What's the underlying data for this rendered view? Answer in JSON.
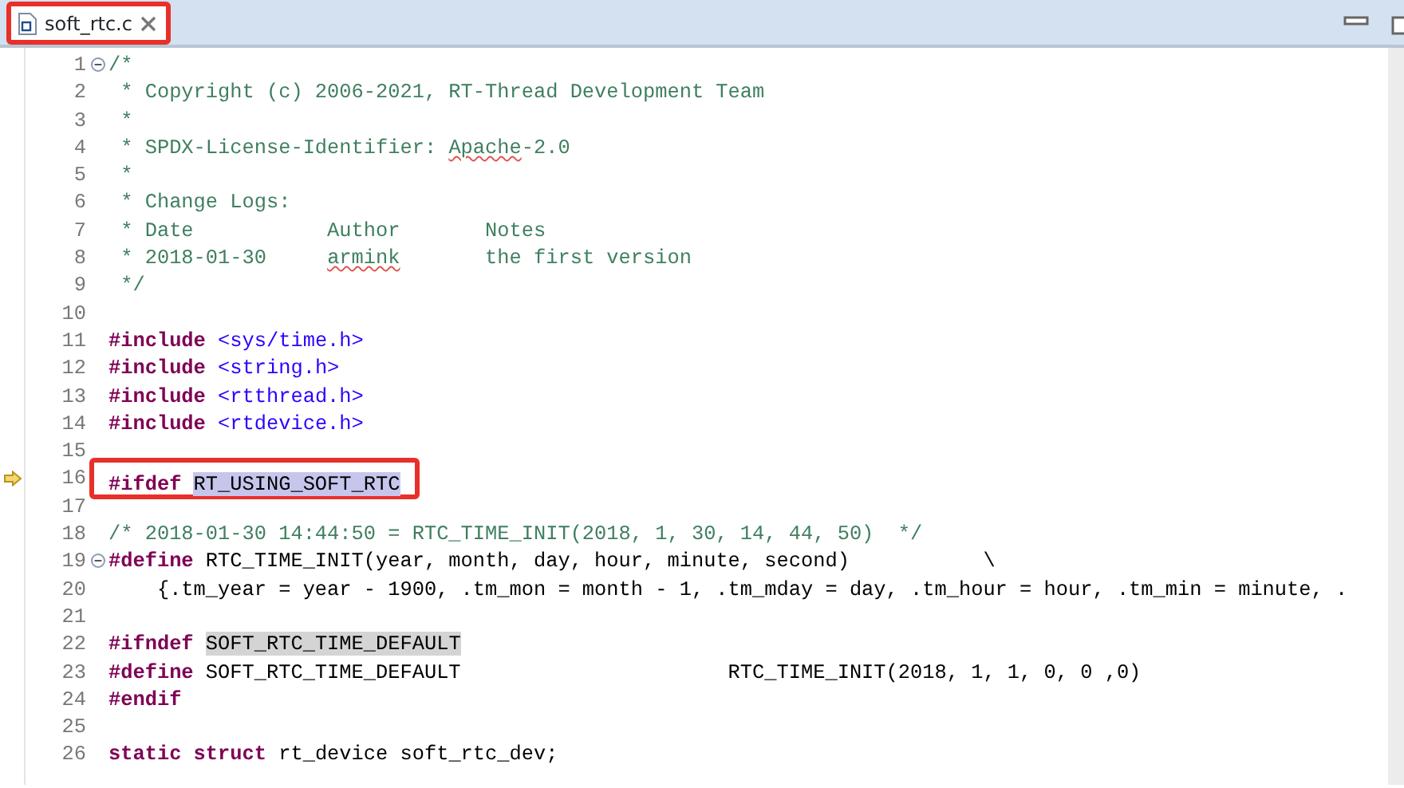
{
  "tab": {
    "title": "soft_rtc.c",
    "annotated": true
  },
  "lines": [
    {
      "number": "1",
      "fold": true,
      "marker": false,
      "boxed": false,
      "tokens": [
        {
          "kind": "comment",
          "text": "/*"
        }
      ]
    },
    {
      "number": "2",
      "fold": false,
      "marker": false,
      "boxed": false,
      "tokens": [
        {
          "kind": "comment",
          "text": " * Copyright (c) 2006-2021, RT-Thread Development Team"
        }
      ]
    },
    {
      "number": "3",
      "fold": false,
      "marker": false,
      "boxed": false,
      "tokens": [
        {
          "kind": "comment",
          "text": " *"
        }
      ]
    },
    {
      "number": "4",
      "fold": false,
      "marker": false,
      "boxed": false,
      "tokens": [
        {
          "kind": "comment",
          "text": " * SPDX-License-Identifier: "
        },
        {
          "kind": "comment-misspelled",
          "text": "Apache"
        },
        {
          "kind": "comment",
          "text": "-2.0"
        }
      ]
    },
    {
      "number": "5",
      "fold": false,
      "marker": false,
      "boxed": false,
      "tokens": [
        {
          "kind": "comment",
          "text": " *"
        }
      ]
    },
    {
      "number": "6",
      "fold": false,
      "marker": false,
      "boxed": false,
      "tokens": [
        {
          "kind": "comment",
          "text": " * Change Logs:"
        }
      ]
    },
    {
      "number": "7",
      "fold": false,
      "marker": false,
      "boxed": false,
      "tokens": [
        {
          "kind": "comment",
          "text": " * Date           Author       Notes"
        }
      ]
    },
    {
      "number": "8",
      "fold": false,
      "marker": false,
      "boxed": false,
      "tokens": [
        {
          "kind": "comment",
          "text": " * 2018-01-30     "
        },
        {
          "kind": "comment-misspelled",
          "text": "armink"
        },
        {
          "kind": "comment",
          "text": "       the first version"
        }
      ]
    },
    {
      "number": "9",
      "fold": false,
      "marker": false,
      "boxed": false,
      "tokens": [
        {
          "kind": "comment",
          "text": " */"
        }
      ]
    },
    {
      "number": "10",
      "fold": false,
      "marker": false,
      "boxed": false
    },
    {
      "number": "11",
      "fold": false,
      "marker": false,
      "boxed": false,
      "tokens": [
        {
          "kind": "keyword",
          "text": "#include "
        },
        {
          "kind": "header",
          "text": "<sys/time.h>"
        }
      ]
    },
    {
      "number": "12",
      "fold": false,
      "marker": false,
      "boxed": false,
      "tokens": [
        {
          "kind": "keyword",
          "text": "#include "
        },
        {
          "kind": "header",
          "text": "<string.h>"
        }
      ]
    },
    {
      "number": "13",
      "fold": false,
      "marker": false,
      "boxed": false,
      "tokens": [
        {
          "kind": "keyword",
          "text": "#include "
        },
        {
          "kind": "header",
          "text": "<rtthread.h>"
        }
      ]
    },
    {
      "number": "14",
      "fold": false,
      "marker": false,
      "boxed": false,
      "tokens": [
        {
          "kind": "keyword",
          "text": "#include "
        },
        {
          "kind": "header",
          "text": "<rtdevice.h>"
        }
      ]
    },
    {
      "number": "15",
      "fold": false,
      "marker": false,
      "boxed": false
    },
    {
      "number": "16",
      "fold": false,
      "marker": true,
      "boxed": true,
      "tokens": [
        {
          "kind": "keyword",
          "text": "#ifdef "
        },
        {
          "kind": "selected",
          "text": "RT_USING_SOFT_RTC"
        }
      ]
    },
    {
      "number": "17",
      "fold": false,
      "marker": false,
      "boxed": false
    },
    {
      "number": "18",
      "fold": false,
      "marker": false,
      "boxed": false,
      "tokens": [
        {
          "kind": "comment",
          "text": "/* 2018-01-30 14:44:50 = RTC_TIME_INIT(2018, 1, 30, 14, 44, 50)  */"
        }
      ]
    },
    {
      "number": "19",
      "fold": true,
      "marker": false,
      "boxed": false,
      "tokens": [
        {
          "kind": "keyword",
          "text": "#define"
        },
        {
          "kind": "plain",
          "text": " RTC_TIME_INIT(year, month, day, hour, minute, second)           \\"
        }
      ]
    },
    {
      "number": "20",
      "fold": false,
      "marker": false,
      "boxed": false,
      "tokens": [
        {
          "kind": "plain",
          "text": "    {.tm_year = year - 1900, .tm_mon = month - 1, .tm_mday = day, .tm_hour = hour, .tm_min = minute, ."
        }
      ]
    },
    {
      "number": "21",
      "fold": false,
      "marker": false,
      "boxed": false
    },
    {
      "number": "22",
      "fold": false,
      "marker": false,
      "boxed": false,
      "tokens": [
        {
          "kind": "keyword",
          "text": "#ifndef "
        },
        {
          "kind": "occurrence",
          "text": "SOFT_RTC_TIME_DEFAULT"
        }
      ]
    },
    {
      "number": "23",
      "fold": false,
      "marker": false,
      "boxed": false,
      "tokens": [
        {
          "kind": "keyword",
          "text": "#define"
        },
        {
          "kind": "plain",
          "text": " SOFT_RTC_TIME_DEFAULT                      RTC_TIME_INIT(2018, 1, 1, 0, 0 ,0)"
        }
      ]
    },
    {
      "number": "24",
      "fold": false,
      "marker": false,
      "boxed": false,
      "tokens": [
        {
          "kind": "keyword",
          "text": "#endif"
        }
      ]
    },
    {
      "number": "25",
      "fold": false,
      "marker": false,
      "boxed": false
    },
    {
      "number": "26",
      "fold": false,
      "marker": false,
      "boxed": false,
      "tokens": [
        {
          "kind": "keyword",
          "text": "static struct"
        },
        {
          "kind": "plain",
          "text": " rt_device soft_rtc_dev;"
        }
      ]
    }
  ]
}
